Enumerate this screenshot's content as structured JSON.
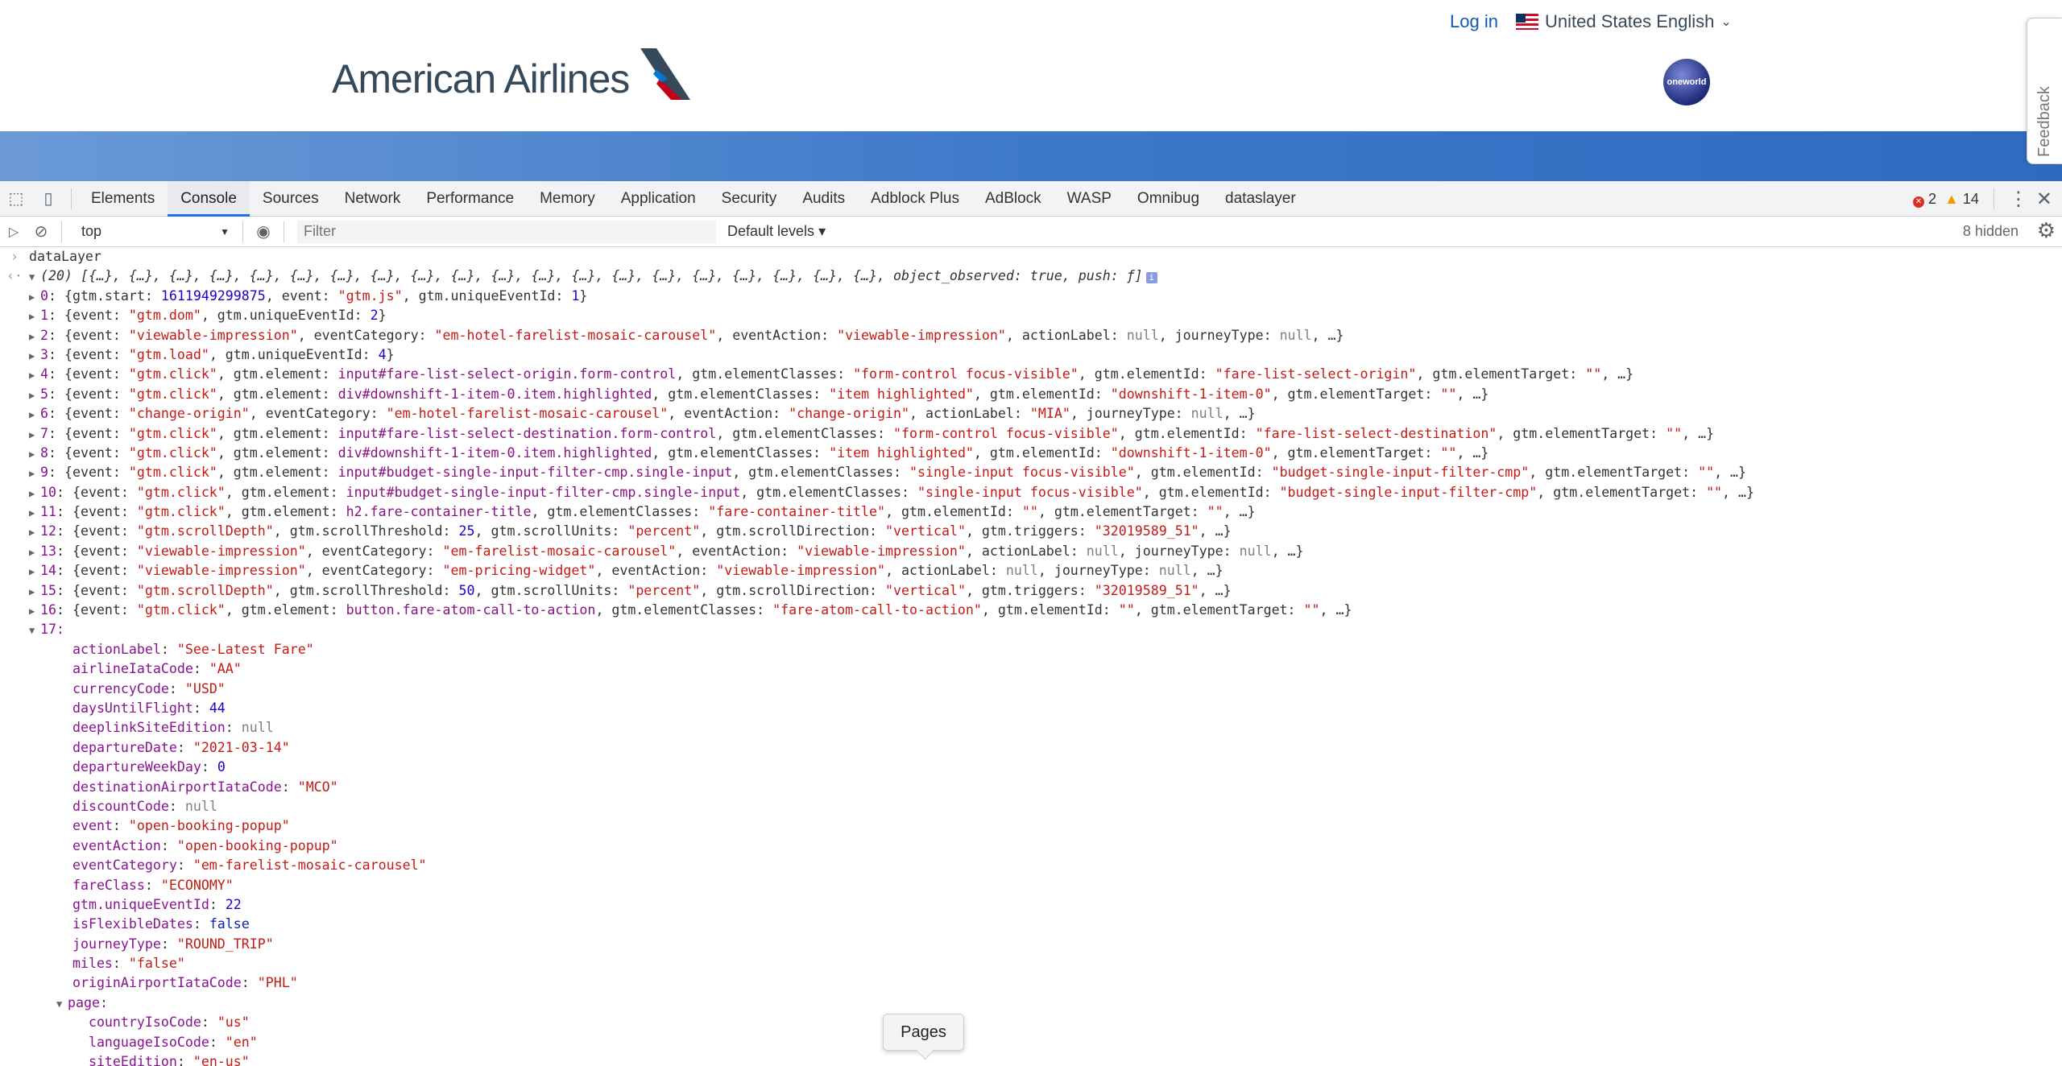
{
  "site": {
    "login": "Log in",
    "locale": "United States English",
    "logo_text": "American Airlines",
    "oneworld": "oneworld",
    "feedback": "Feedback"
  },
  "devtools": {
    "tabs": [
      "Elements",
      "Console",
      "Sources",
      "Network",
      "Performance",
      "Memory",
      "Application",
      "Security",
      "Audits",
      "Adblock Plus",
      "AdBlock",
      "WASP",
      "Omnibug",
      "dataslayer"
    ],
    "active_tab": "Console",
    "errors": "2",
    "warnings": "14",
    "context": "top",
    "filter_placeholder": "Filter",
    "levels": "Default levels",
    "hidden": "8 hidden"
  },
  "console": {
    "input": "dataLayer",
    "array_summary": "(20) [{…}, {…}, {…}, {…}, {…}, {…}, {…}, {…}, {…}, {…}, {…}, {…}, {…}, {…}, {…}, {…}, {…}, {…}, {…}, {…}, object_observed: true, push: ƒ]",
    "entries": [
      "0: {gtm.start: 1611949299875, event: \"gtm.js\", gtm.uniqueEventId: 1}",
      "1: {event: \"gtm.dom\", gtm.uniqueEventId: 2}",
      "2: {event: \"viewable-impression\", eventCategory: \"em-hotel-farelist-mosaic-carousel\", eventAction: \"viewable-impression\", actionLabel: null, journeyType: null, …}",
      "3: {event: \"gtm.load\", gtm.uniqueEventId: 4}",
      "4: {event: \"gtm.click\", gtm.element: input#fare-list-select-origin.form-control, gtm.elementClasses: \"form-control focus-visible\", gtm.elementId: \"fare-list-select-origin\", gtm.elementTarget: \"\", …}",
      "5: {event: \"gtm.click\", gtm.element: div#downshift-1-item-0.item.highlighted, gtm.elementClasses: \"item highlighted\", gtm.elementId: \"downshift-1-item-0\", gtm.elementTarget: \"\", …}",
      "6: {event: \"change-origin\", eventCategory: \"em-hotel-farelist-mosaic-carousel\", eventAction: \"change-origin\", actionLabel: \"MIA\", journeyType: null, …}",
      "7: {event: \"gtm.click\", gtm.element: input#fare-list-select-destination.form-control, gtm.elementClasses: \"form-control focus-visible\", gtm.elementId: \"fare-list-select-destination\", gtm.elementTarget: \"\", …}",
      "8: {event: \"gtm.click\", gtm.element: div#downshift-1-item-0.item.highlighted, gtm.elementClasses: \"item highlighted\", gtm.elementId: \"downshift-1-item-0\", gtm.elementTarget: \"\", …}",
      "9: {event: \"gtm.click\", gtm.element: input#budget-single-input-filter-cmp.single-input, gtm.elementClasses: \"single-input focus-visible\", gtm.elementId: \"budget-single-input-filter-cmp\", gtm.elementTarget: \"\", …}",
      "10: {event: \"gtm.click\", gtm.element: input#budget-single-input-filter-cmp.single-input, gtm.elementClasses: \"single-input focus-visible\", gtm.elementId: \"budget-single-input-filter-cmp\", gtm.elementTarget: \"\", …}",
      "11: {event: \"gtm.click\", gtm.element: h2.fare-container-title, gtm.elementClasses: \"fare-container-title\", gtm.elementId: \"\", gtm.elementTarget: \"\", …}",
      "12: {event: \"gtm.scrollDepth\", gtm.scrollThreshold: 25, gtm.scrollUnits: \"percent\", gtm.scrollDirection: \"vertical\", gtm.triggers: \"32019589_51\", …}",
      "13: {event: \"viewable-impression\", eventCategory: \"em-farelist-mosaic-carousel\", eventAction: \"viewable-impression\", actionLabel: null, journeyType: null, …}",
      "14: {event: \"viewable-impression\", eventCategory: \"em-pricing-widget\", eventAction: \"viewable-impression\", actionLabel: null, journeyType: null, …}",
      "15: {event: \"gtm.scrollDepth\", gtm.scrollThreshold: 50, gtm.scrollUnits: \"percent\", gtm.scrollDirection: \"vertical\", gtm.triggers: \"32019589_51\", …}",
      "16: {event: \"gtm.click\", gtm.element: button.fare-atom-call-to-action, gtm.elementClasses: \"fare-atom-call-to-action\", gtm.elementId: \"\", gtm.elementTarget: \"\", …}"
    ],
    "expanded_index": "17:",
    "props": [
      {
        "k": "actionLabel",
        "v": "\"See-Latest Fare\"",
        "t": "s"
      },
      {
        "k": "airlineIataCode",
        "v": "\"AA\"",
        "t": "s"
      },
      {
        "k": "currencyCode",
        "v": "\"USD\"",
        "t": "s"
      },
      {
        "k": "daysUntilFlight",
        "v": "44",
        "t": "n"
      },
      {
        "k": "deeplinkSiteEdition",
        "v": "null",
        "t": "nul"
      },
      {
        "k": "departureDate",
        "v": "\"2021-03-14\"",
        "t": "s"
      },
      {
        "k": "departureWeekDay",
        "v": "0",
        "t": "n"
      },
      {
        "k": "destinationAirportIataCode",
        "v": "\"MCO\"",
        "t": "s"
      },
      {
        "k": "discountCode",
        "v": "null",
        "t": "nul"
      },
      {
        "k": "event",
        "v": "\"open-booking-popup\"",
        "t": "s"
      },
      {
        "k": "eventAction",
        "v": "\"open-booking-popup\"",
        "t": "s"
      },
      {
        "k": "eventCategory",
        "v": "\"em-farelist-mosaic-carousel\"",
        "t": "s"
      },
      {
        "k": "fareClass",
        "v": "\"ECONOMY\"",
        "t": "s"
      },
      {
        "k": "gtm.uniqueEventId",
        "v": "22",
        "t": "n"
      },
      {
        "k": "isFlexibleDates",
        "v": "false",
        "t": "b"
      },
      {
        "k": "journeyType",
        "v": "\"ROUND_TRIP\"",
        "t": "s"
      },
      {
        "k": "miles",
        "v": "\"false\"",
        "t": "s"
      },
      {
        "k": "originAirportIataCode",
        "v": "\"PHL\"",
        "t": "s"
      }
    ],
    "page_key": "page:",
    "page_props": [
      {
        "k": "countryIsoCode",
        "v": "\"us\"",
        "t": "s"
      },
      {
        "k": "languageIsoCode",
        "v": "\"en\"",
        "t": "s"
      },
      {
        "k": "siteEdition",
        "v": "\"en-us\"",
        "t": "s"
      }
    ]
  },
  "tooltip": "Pages",
  "colors": {
    "accent": "#1a73e8",
    "string": "#c41a16",
    "key": "#881391",
    "number": "#1c00cf"
  }
}
